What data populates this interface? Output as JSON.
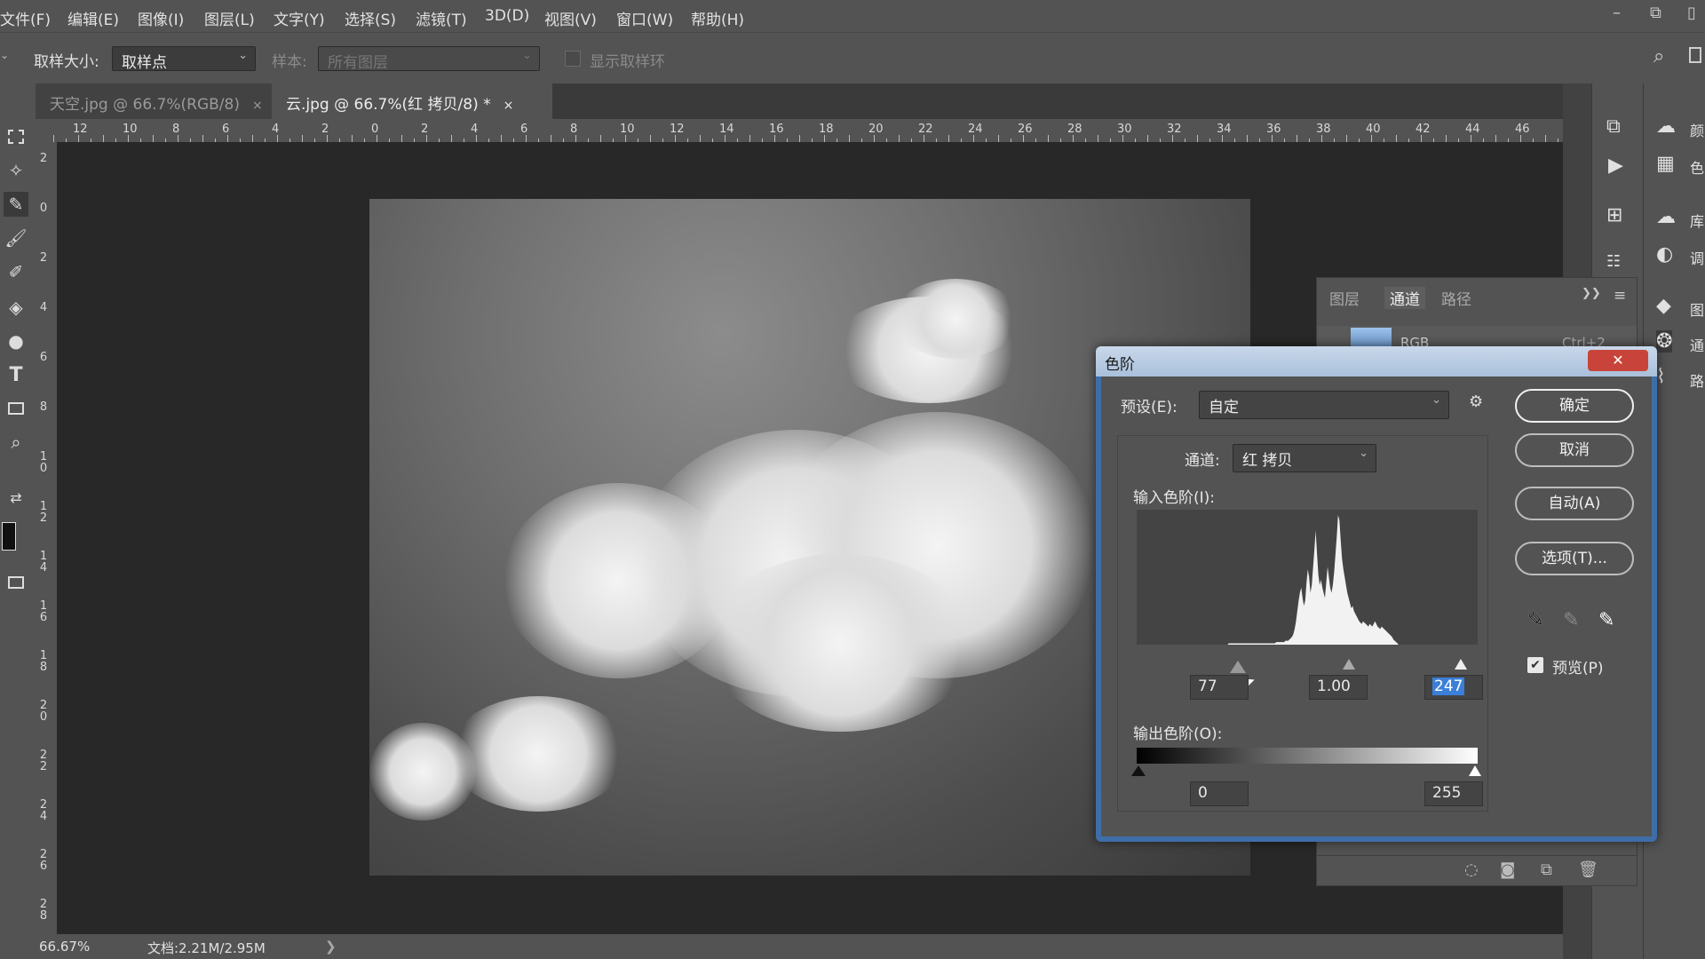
{
  "menubar": {
    "items": [
      "文件(F)",
      "编辑(E)",
      "图像(I)",
      "图层(L)",
      "文字(Y)",
      "选择(S)",
      "滤镜(T)",
      "3D(D)",
      "视图(V)",
      "窗口(W)",
      "帮助(H)"
    ],
    "window_controls": [
      "–",
      "⧉",
      "▯"
    ]
  },
  "options": {
    "sample_size_label": "取样大小:",
    "sample_size_value": "取样点",
    "sample_label": "样本:",
    "sample_value": "所有图层",
    "show_ring_label": "显示取样环"
  },
  "tabs": [
    {
      "label": "天空.jpg @ 66.7%(RGB/8)",
      "close": "×"
    },
    {
      "label": "云.jpg @ 66.7%(红 拷贝/8) *",
      "close": "×"
    }
  ],
  "rulers": {
    "horizontal": [
      "12",
      "10",
      "8",
      "6",
      "4",
      "2",
      "0",
      "2",
      "4",
      "6",
      "8",
      "10",
      "12",
      "14",
      "16",
      "18",
      "20",
      "22",
      "24",
      "26",
      "28",
      "30",
      "32",
      "34",
      "36",
      "38",
      "40",
      "42",
      "44",
      "46"
    ],
    "vertical": [
      "2",
      "0",
      "2",
      "4",
      "6",
      "8",
      "10",
      "12",
      "14",
      "16",
      "18",
      "20",
      "22",
      "24",
      "26",
      "28"
    ]
  },
  "status": {
    "zoom": "66.67%",
    "doc": "文档:2.21M/2.95M",
    "arrow": "❯"
  },
  "channels_panel": {
    "tabs": [
      "图层",
      "通道",
      "路径"
    ],
    "active_tab": "通道",
    "row_name": "RGB",
    "row_shortcut": "Ctrl+2",
    "menu_glyphs": [
      "❯❯",
      "≡"
    ]
  },
  "right_labels": [
    "颜",
    "色",
    "库",
    "调",
    "图",
    "通",
    "路"
  ],
  "levels_dialog": {
    "title": "色阶",
    "close": "✕",
    "preset_label": "预设(E):",
    "preset_value": "自定",
    "channel_label": "通道:",
    "channel_value": "红 拷贝",
    "input_label": "输入色阶(I):",
    "input_black": "77",
    "input_gamma": "1.00",
    "input_white": "247",
    "output_label": "输出色阶(O):",
    "output_black": "0",
    "output_white": "255",
    "buttons": {
      "ok": "确定",
      "cancel": "取消",
      "auto": "自动(A)",
      "options": "选项(T)..."
    },
    "preview_label": "预览(P)",
    "preview_checked": true,
    "histogram": [
      0,
      0,
      0,
      0,
      0,
      0,
      0,
      0,
      0,
      0,
      0,
      0,
      0,
      0,
      0,
      0,
      0,
      0,
      0,
      0,
      0,
      0,
      0,
      0,
      0,
      0,
      0,
      0,
      0,
      0,
      0,
      0,
      0,
      0,
      0,
      0,
      0,
      0,
      0,
      0,
      0,
      0,
      0,
      0,
      0,
      0,
      0,
      0,
      0,
      0,
      0,
      0,
      0,
      0,
      0,
      0,
      0,
      0,
      0,
      0,
      0,
      0,
      0,
      0,
      0,
      0,
      0,
      0,
      0,
      0,
      1,
      1,
      1,
      1,
      1,
      1,
      1,
      1,
      1,
      1,
      1,
      1,
      1,
      1,
      1,
      1,
      1,
      1,
      1,
      1,
      1,
      1,
      1,
      1,
      1,
      1,
      1,
      1,
      1,
      1,
      1,
      1,
      1,
      1,
      1,
      1,
      2,
      2,
      2,
      2,
      2,
      2,
      2,
      3,
      3,
      3,
      4,
      5,
      6,
      8,
      12,
      18,
      26,
      34,
      40,
      44,
      36,
      30,
      34,
      48,
      58,
      52,
      40,
      46,
      60,
      74,
      88,
      70,
      54,
      46,
      50,
      44,
      40,
      36,
      48,
      60,
      52,
      44,
      40,
      46,
      56,
      70,
      84,
      100,
      96,
      80,
      66,
      58,
      52,
      46,
      40,
      36,
      32,
      28,
      30,
      26,
      24,
      22,
      20,
      18,
      17,
      16,
      18,
      17,
      16,
      15,
      14,
      16,
      15,
      14,
      16,
      18,
      16,
      14,
      13,
      12,
      14,
      13,
      12,
      11,
      10,
      9,
      8,
      7,
      6,
      4,
      3,
      2,
      1,
      0,
      0,
      0,
      0,
      0,
      0,
      0,
      0,
      0,
      0,
      0,
      0,
      0,
      0,
      0,
      0,
      0,
      0,
      0,
      0,
      0,
      0,
      0,
      0,
      0,
      0,
      0,
      0,
      0,
      0,
      0,
      0,
      0,
      0,
      0,
      0,
      0,
      0,
      0,
      0,
      0,
      0,
      0,
      0,
      0,
      0,
      0,
      0,
      0,
      0,
      0,
      0,
      0,
      0,
      0,
      0,
      0,
      0,
      0,
      0,
      0
    ]
  },
  "colors": {
    "dialog_frame": "#3e6ea8",
    "close_button": "#c8443a",
    "selected_field": "#3b7fd9",
    "panel": "#535353"
  }
}
